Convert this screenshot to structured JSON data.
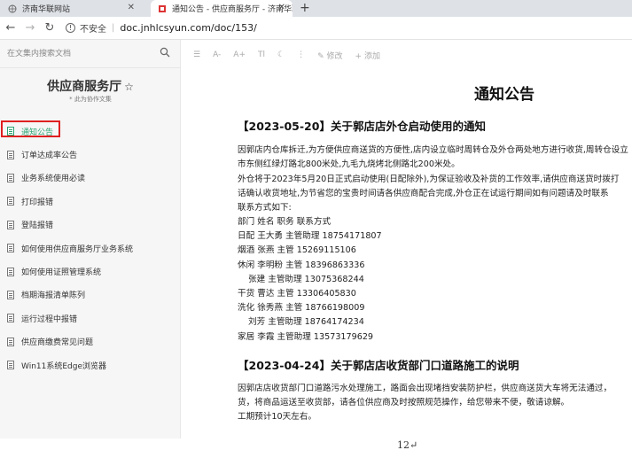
{
  "browser": {
    "tabs": [
      {
        "title": "济南华联网站"
      },
      {
        "title": "通知公告 - 供应商服务厅 - 济南华联"
      }
    ],
    "new_tab": "+",
    "security_label": "不安全",
    "url": "doc.jnhlcsyun.com/doc/153/"
  },
  "sidebar": {
    "search_placeholder": "在文集内搜索文档",
    "title": "供应商服务厅",
    "subtitle": "* 此为协作文集",
    "items": [
      {
        "label": "通知公告"
      },
      {
        "label": "订单达成率公告"
      },
      {
        "label": "业务系统使用必读"
      },
      {
        "label": "打印报错"
      },
      {
        "label": "登陆报错"
      },
      {
        "label": "如何使用供应商服务厅业务系统"
      },
      {
        "label": "如何使用证照管理系统"
      },
      {
        "label": "档期海报清单陈列"
      },
      {
        "label": "运行过程中报错"
      },
      {
        "label": "供应商缴费常见问题"
      },
      {
        "label": "Win11系统Edge浏览器"
      }
    ]
  },
  "toolbar": {
    "font_smaller": "A-",
    "font_larger": "A+",
    "font_type": "Tl",
    "edit_label": "修改",
    "add_label": "添加"
  },
  "doc": {
    "title": "通知公告",
    "section1": {
      "heading": "【2023-05-20】关于郭店店外仓启动使用的通知",
      "lines": [
        "因郭店内仓库拆迁,为方便供应商送货的方便性,店内设立临时周转仓及外仓两处地方进行收货,周转仓设立",
        "市东侧红绿灯路北800米处,九毛九烧烤北侧路北200米处。",
        "外仓将于2023年5月20日正式启动使用(日配除外),为保证验收及补货的工作效率,请供应商送货时拨打",
        "话确认收货地址,为节省您的宝贵时间请各供应商配合完成,外仓正在试运行期间如有问题请及时联系",
        "联系方式如下:"
      ],
      "contacts": [
        {
          "text": "部门 姓名 职务 联系方式",
          "indent": false
        },
        {
          "text": "日配 王大勇 主管助理 18754171807",
          "indent": false
        },
        {
          "text": "烟酒 张燕 主管 15269115106",
          "indent": false
        },
        {
          "text": "休闲 李明粉 主管 18396863336",
          "indent": false
        },
        {
          "text": "张建 主管助理 13075368244",
          "indent": true
        },
        {
          "text": "干货 曹达 主管 13306405830",
          "indent": false
        },
        {
          "text": "洗化 徐秀燕 主管 18766198009",
          "indent": false
        },
        {
          "text": "刘芳 主管助理 18764174234",
          "indent": true
        },
        {
          "text": "家居 李霞 主管助理 13573179629",
          "indent": false
        }
      ]
    },
    "section2": {
      "heading": "【2023-04-24】关于郭店店收货部门口道路施工的说明",
      "lines": [
        "因郭店店收货部门口道路污水处理施工，路面会出现堵挡安装防护栏，供应商送货大车将无法通过，",
        "货，将商品运送至收货部，请各位供应商及时按照规范操作，给您带来不便，敬请谅解。",
        "工期预计10天左右。"
      ]
    }
  },
  "page_number": "12↵"
}
